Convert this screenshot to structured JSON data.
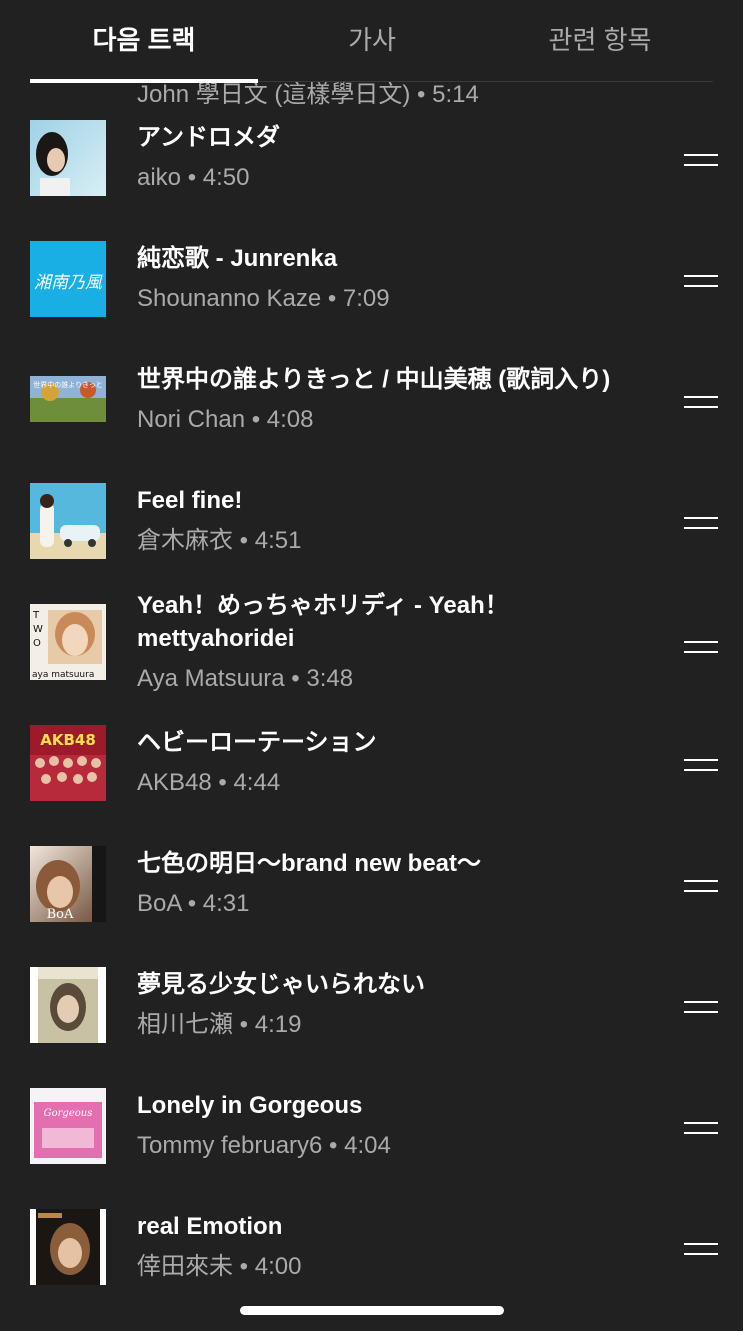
{
  "tabs": [
    {
      "label": "다음 트랙",
      "active": true
    },
    {
      "label": "가사",
      "active": false
    },
    {
      "label": "관련 항목",
      "active": false
    }
  ],
  "colors": {
    "background": "#212121",
    "text_primary": "#ffffff",
    "text_secondary": "#aaaaaa",
    "divider": "#3a3a3a"
  },
  "queue": [
    {
      "title": "",
      "artist": "John 學日文 (這樣學日文)",
      "duration": "5:14",
      "subtitle": "John 學日文 (這樣學日文) • 5:14",
      "thumb": "dark-banner"
    },
    {
      "title": "アンドロメダ",
      "artist": "aiko",
      "duration": "4:50",
      "subtitle": "aiko • 4:50",
      "thumb": "aiko"
    },
    {
      "title": "純恋歌 - Junrenka",
      "artist": "Shounanno Kaze",
      "duration": "7:09",
      "subtitle": "Shounanno Kaze • 7:09",
      "thumb": "blue-logo",
      "thumb_text": "湘南乃風"
    },
    {
      "title": "世界中の誰よりきっと / 中山美穂 (歌詞入り)",
      "artist": "Nori Chan",
      "duration": "4:08",
      "subtitle": "Nori Chan • 4:08",
      "thumb": "landscape",
      "thumb_text": "世界中の誰よりきっと"
    },
    {
      "title": "Feel fine!",
      "artist": "倉木麻衣",
      "duration": "4:51",
      "subtitle": "倉木麻衣 • 4:51",
      "thumb": "beach-car"
    },
    {
      "title": "Yeah！めっちゃホリディ - Yeah！",
      "title_line2": "mettyahoridei",
      "artist": "Aya Matsuura",
      "duration": "3:48",
      "subtitle": "Aya Matsuura • 3:48",
      "thumb": "aya",
      "thumb_text": "aya matsuura",
      "thumb_text_2": "TWO"
    },
    {
      "title": "ヘビーローテーション",
      "artist": "AKB48",
      "duration": "4:44",
      "subtitle": "AKB48 • 4:44",
      "thumb": "akb",
      "thumb_text": "AKB48"
    },
    {
      "title": "七色の明日～brand new beat～",
      "artist": "BoA",
      "duration": "4:31",
      "subtitle": "BoA • 4:31",
      "thumb": "boa",
      "thumb_text": "BoA"
    },
    {
      "title": "夢見る少女じゃいられない",
      "artist": "相川七瀬",
      "duration": "4:19",
      "subtitle": "相川七瀬 • 4:19",
      "thumb": "nanase"
    },
    {
      "title": "Lonely in Gorgeous",
      "artist": "Tommy february6",
      "duration": "4:04",
      "subtitle": "Tommy february6 • 4:04",
      "thumb": "pink",
      "thumb_text": "Gorgeous"
    },
    {
      "title": "real Emotion",
      "artist": "倖田來未",
      "duration": "4:00",
      "subtitle": "倖田來未 • 4:00",
      "thumb": "koda"
    }
  ]
}
